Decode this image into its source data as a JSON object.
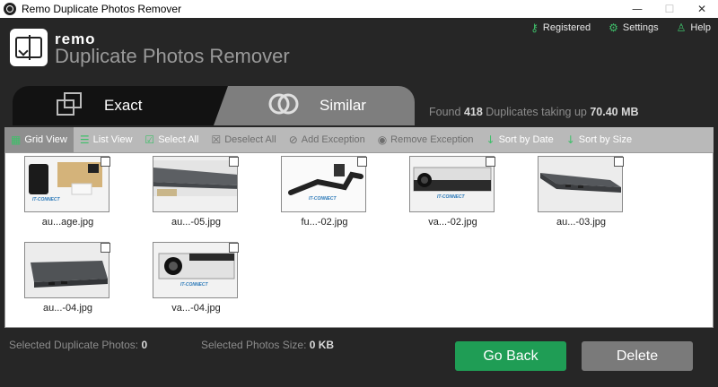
{
  "window": {
    "title": "Remo Duplicate Photos Remover",
    "minimize_glyph": "—",
    "maximize_glyph": "☐",
    "close_glyph": "✕"
  },
  "header": {
    "brand": "remo",
    "product": "Duplicate Photos Remover",
    "links": [
      {
        "label": "Registered",
        "icon": "key-icon"
      },
      {
        "label": "Settings",
        "icon": "gear-icon"
      },
      {
        "label": "Help",
        "icon": "person-icon"
      }
    ]
  },
  "tabs": [
    {
      "label": "Exact",
      "icon": "overlapping-squares-icon",
      "active": true
    },
    {
      "label": "Similar",
      "icon": "overlapping-circles-icon",
      "active": false
    }
  ],
  "summary": {
    "prefix": "Found",
    "count": "418",
    "middle": "Duplicates taking up",
    "size": "70.40 MB"
  },
  "toolbar": [
    {
      "label": "Grid View",
      "icon": "grid-icon",
      "active": true,
      "enabled": true
    },
    {
      "label": "List View",
      "icon": "list-icon",
      "active": false,
      "enabled": true
    },
    {
      "label": "Select All",
      "icon": "select-all-icon",
      "active": false,
      "enabled": true
    },
    {
      "label": "Deselect All",
      "icon": "deselect-icon",
      "active": false,
      "enabled": false
    },
    {
      "label": "Add Exception",
      "icon": "eye-slash-icon",
      "active": false,
      "enabled": false
    },
    {
      "label": "Remove Exception",
      "icon": "eye-icon",
      "active": false,
      "enabled": false
    },
    {
      "label": "Sort by Date",
      "icon": "arrow-down-icon",
      "active": false,
      "enabled": true
    },
    {
      "label": "Sort by Size",
      "icon": "arrow-down-icon",
      "active": false,
      "enabled": true
    }
  ],
  "photos": [
    {
      "name": "au...age.jpg",
      "checked": false
    },
    {
      "name": "au...-05.jpg",
      "checked": false
    },
    {
      "name": "fu...-02.jpg",
      "checked": false,
      "watermark": "IT-CONNECT"
    },
    {
      "name": "va...-02.jpg",
      "checked": false,
      "watermark": "IT-CONNECT"
    },
    {
      "name": "au...-03.jpg",
      "checked": false
    },
    {
      "name": "au...-04.jpg",
      "checked": false
    },
    {
      "name": "va...-04.jpg",
      "checked": false,
      "watermark": "IT-CONNECT"
    }
  ],
  "photo1_watermark": "IT-CONNECT",
  "footer": {
    "selected_label": "Selected Duplicate Photos:",
    "selected_value": "0",
    "size_label": "Selected Photos Size:",
    "size_value": "0 KB",
    "back_label": "Go Back",
    "delete_label": "Delete"
  },
  "colors": {
    "accent_green": "#1f9d55",
    "icon_green": "#3fbf6a",
    "background": "#262626"
  }
}
